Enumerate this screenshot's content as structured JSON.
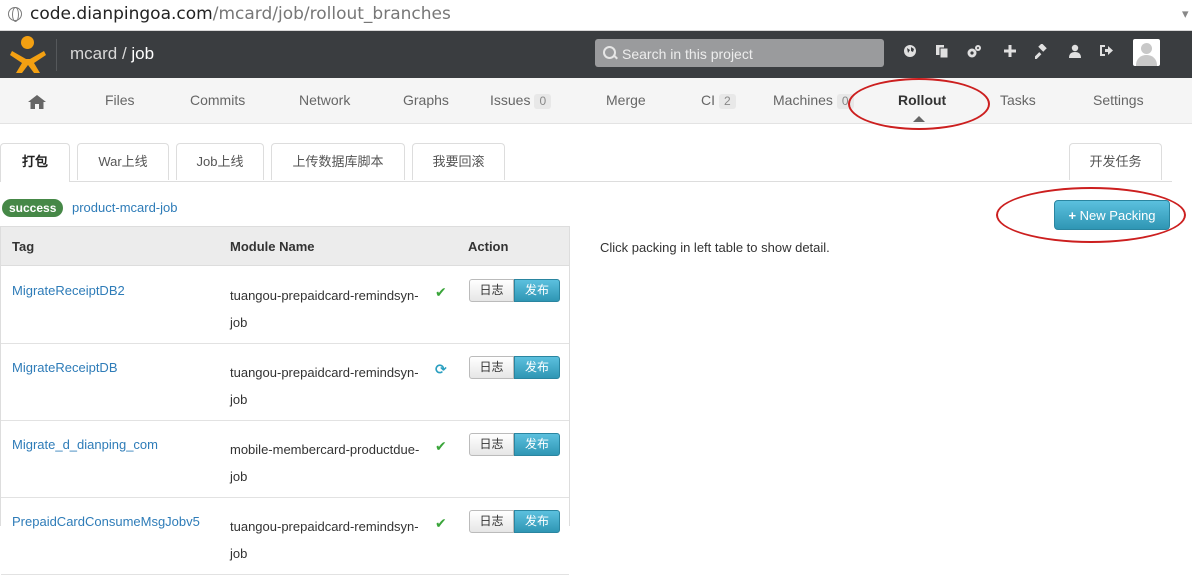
{
  "browser": {
    "url_host": "code.dianpingoa.com",
    "url_path": "/mcard/job/rollout_branches"
  },
  "header": {
    "project_prefix": "mcard / ",
    "project_name": "job",
    "search_placeholder": "Search in this project",
    "icons": [
      "globe-icon",
      "copy-icon",
      "cogs-icon",
      "plus-icon",
      "gavel-icon",
      "user-icon",
      "signout-icon"
    ]
  },
  "nav": {
    "items": [
      {
        "label": "Files"
      },
      {
        "label": "Commits"
      },
      {
        "label": "Network"
      },
      {
        "label": "Graphs"
      },
      {
        "label": "Issues",
        "badge": "0"
      },
      {
        "label": "Merge"
      },
      {
        "label": "CI",
        "badge": "2"
      },
      {
        "label": "Machines",
        "badge": "0"
      },
      {
        "label": "Rollout"
      },
      {
        "label": "Tasks"
      },
      {
        "label": "Settings"
      }
    ],
    "active": "Rollout"
  },
  "tabs": {
    "items": [
      "打包",
      "War上线",
      "Job上线",
      "上传数据库脚本",
      "我要回滚"
    ],
    "right": "开发任务",
    "active": "打包"
  },
  "status": {
    "badge": "success",
    "link": "product-mcard-job"
  },
  "actions": {
    "new_packing": "New Packing"
  },
  "detail": {
    "text": "Click packing in left table to show detail."
  },
  "table": {
    "headers": [
      "Tag",
      "Module Name",
      "Action"
    ],
    "rows": [
      {
        "tag": "MigrateReceiptDB2",
        "module": "tuangou-prepaidcard-remindsyn-job",
        "state": "ok",
        "log": "日志",
        "publish": "发布"
      },
      {
        "tag": "MigrateReceiptDB",
        "module": "tuangou-prepaidcard-remindsyn-job",
        "state": "running",
        "log": "日志",
        "publish": "发布"
      },
      {
        "tag": "Migrate_d_dianping_com",
        "module": "mobile-membercard-productdue-job",
        "state": "ok",
        "log": "日志",
        "publish": "发布"
      },
      {
        "tag": "PrepaidCardConsumeMsgJobv5",
        "module": "tuangou-prepaidcard-remindsyn-job",
        "state": "ok",
        "log": "日志",
        "publish": "发布"
      }
    ]
  },
  "colors": {
    "header_bg": "#3a3d40",
    "success": "#468847",
    "link": "#2e7cb8",
    "primary": "#2f96b4",
    "annotation": "#cc1f1f"
  }
}
